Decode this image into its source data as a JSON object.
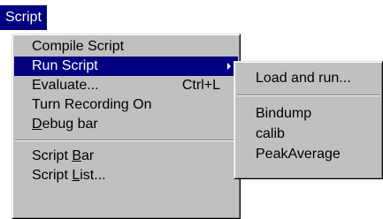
{
  "menubar": {
    "title": "Script"
  },
  "menu": {
    "items": [
      {
        "label": "Compile Script"
      },
      {
        "label": "Run Script",
        "highlighted": true,
        "has_submenu": true
      },
      {
        "label": "Evaluate...",
        "shortcut": "Ctrl+L"
      },
      {
        "label": "Turn Recording On"
      },
      {
        "label": "ebug bar",
        "mnemonic": "D"
      }
    ],
    "items_after_separator": [
      {
        "label_prefix": "Script ",
        "mnemonic": "B",
        "label_suffix": "ar"
      },
      {
        "label_prefix": "Script ",
        "mnemonic": "L",
        "label_suffix": "ist..."
      }
    ]
  },
  "submenu": {
    "items": [
      {
        "label": "Load and run..."
      },
      {
        "label": "Bindump"
      },
      {
        "label": "calib"
      },
      {
        "label": "PeakAverage"
      }
    ]
  },
  "colors": {
    "menu_bg": "#c0c0c0",
    "highlight_bg": "#000080",
    "highlight_fg": "#ffffff"
  },
  "icons": {
    "submenu_arrow": "chevron-right-icon"
  }
}
